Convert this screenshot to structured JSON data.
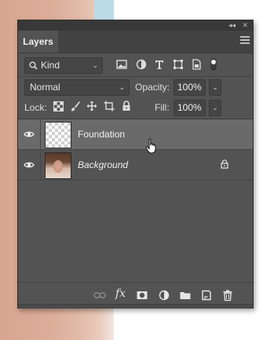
{
  "panel": {
    "tab_label": "Layers"
  },
  "filter": {
    "kind_label": "Kind",
    "icons": [
      "image-filter-icon",
      "adjustment-filter-icon",
      "type-filter-icon",
      "shape-filter-icon",
      "smart-object-filter-icon",
      "filter-toggle-icon"
    ]
  },
  "blend": {
    "mode": "Normal",
    "opacity_label": "Opacity:",
    "opacity_value": "100%"
  },
  "lock": {
    "label": "Lock:",
    "fill_label": "Fill:",
    "fill_value": "100%",
    "icons": [
      "lock-transparent-pixels-icon",
      "lock-image-pixels-icon",
      "lock-position-icon",
      "lock-artboard-icon",
      "lock-all-icon"
    ]
  },
  "layers": [
    {
      "name": "Foundation",
      "selected": true,
      "visible": true,
      "locked": false
    },
    {
      "name": "Background",
      "selected": false,
      "visible": true,
      "locked": true
    }
  ],
  "footer": {
    "icons": [
      "link-layers-icon",
      "fx-icon",
      "add-mask-icon",
      "new-adjustment-icon",
      "new-group-icon",
      "new-layer-icon",
      "delete-layer-icon"
    ],
    "fx_text": "fx"
  },
  "titlebar": {
    "collapse_glyph": "◂◂",
    "close_glyph": "✕"
  }
}
